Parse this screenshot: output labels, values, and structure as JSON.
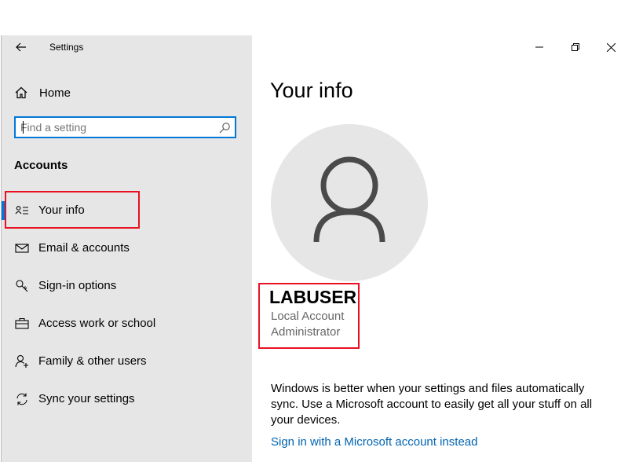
{
  "window": {
    "title": "Settings"
  },
  "sidebar": {
    "home_label": "Home",
    "search": {
      "placeholder": "Find a setting"
    },
    "section_title": "Accounts",
    "items": [
      {
        "label": "Your info",
        "icon": "contact-card-icon",
        "active": true
      },
      {
        "label": "Email & accounts",
        "icon": "mail-icon",
        "active": false
      },
      {
        "label": "Sign-in options",
        "icon": "key-icon",
        "active": false
      },
      {
        "label": "Access work or school",
        "icon": "briefcase-icon",
        "active": false
      },
      {
        "label": "Family & other users",
        "icon": "person-add-icon",
        "active": false
      },
      {
        "label": "Sync your settings",
        "icon": "sync-icon",
        "active": false
      }
    ]
  },
  "main": {
    "title": "Your info",
    "user": {
      "name": "LABUSER",
      "account_type": "Local Account",
      "role": "Administrator"
    },
    "info_text": "Windows is better when your settings and files automatically sync. Use a Microsoft account to easily get all your stuff on all your devices.",
    "ms_link": "Sign in with a Microsoft account instead"
  },
  "colors": {
    "accent": "#0078d7",
    "link": "#0063b1",
    "highlight": "#e81123",
    "sidebar_bg": "#e6e6e6"
  }
}
